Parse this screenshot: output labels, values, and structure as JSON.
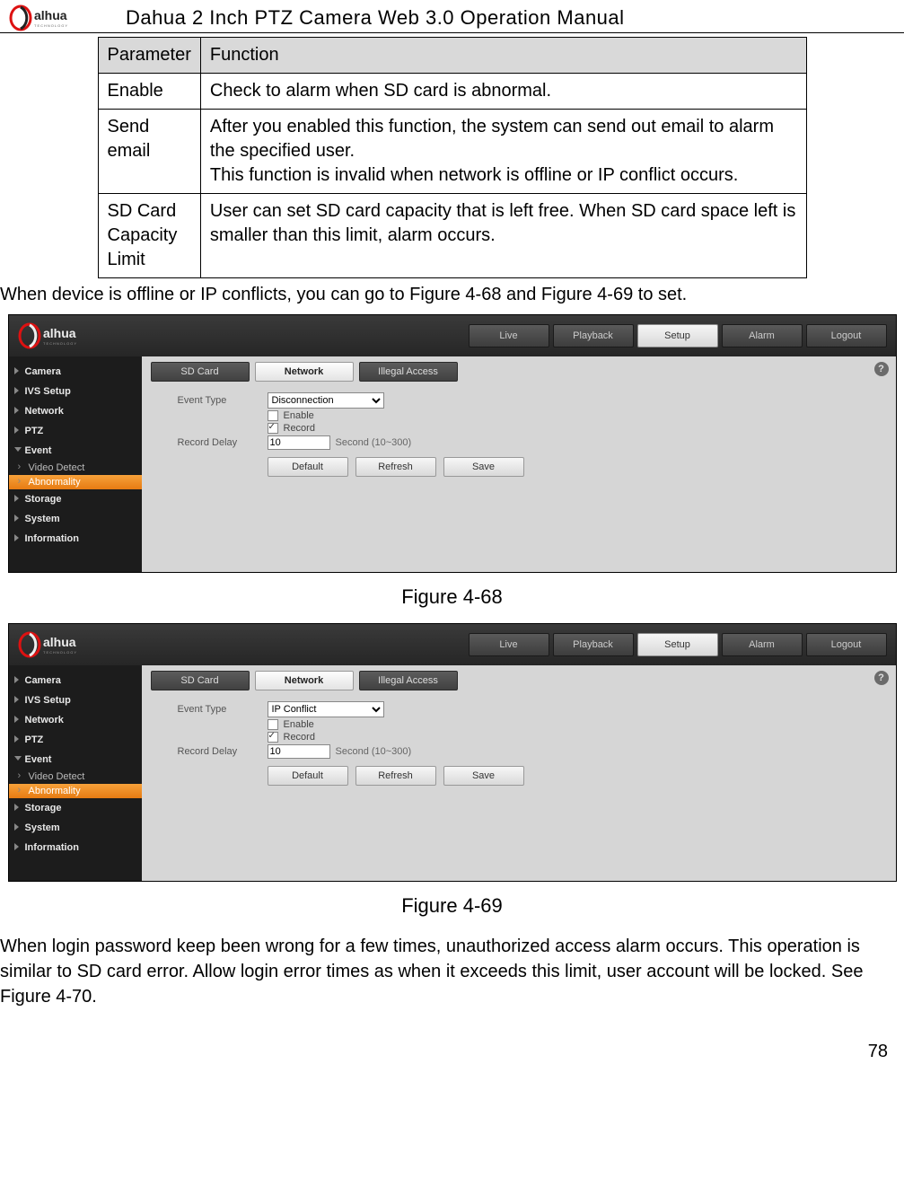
{
  "doc": {
    "title": "Dahua 2 Inch PTZ Camera Web 3.0 Operation Manual",
    "page_number": "78"
  },
  "param_table": {
    "headers": [
      "Parameter",
      "Function"
    ],
    "rows": [
      {
        "param": "Enable",
        "func": "Check to alarm when SD card is abnormal."
      },
      {
        "param": "Send email",
        "func": "After you enabled this function, the system can send out email to alarm the specified user.\nThis function is invalid when network is offline or IP conflict occurs."
      },
      {
        "param": "SD Card Capacity Limit",
        "func": "User can set SD card capacity that is left free. When SD card space left is smaller than this limit, alarm occurs."
      }
    ]
  },
  "text": {
    "intro": "When device is offline or IP conflicts, you can go to Figure 4-68 and Figure 4-69 to set.",
    "fig68": "Figure 4-68",
    "fig69": "Figure 4-69",
    "outro": "When login password keep been wrong for a few times, unauthorized access alarm occurs. This operation is similar to SD card error. Allow login error times as when it exceeds this limit, user account will be locked. See Figure 4-70."
  },
  "topnav": {
    "items": [
      "Live",
      "Playback",
      "Setup",
      "Alarm",
      "Logout"
    ],
    "active": "Setup"
  },
  "sidebar": {
    "items": [
      {
        "label": "Camera",
        "type": "item"
      },
      {
        "label": "IVS Setup",
        "type": "item"
      },
      {
        "label": "Network",
        "type": "item"
      },
      {
        "label": "PTZ",
        "type": "item"
      },
      {
        "label": "Event",
        "type": "item",
        "open": true
      },
      {
        "label": "Video Detect",
        "type": "sub"
      },
      {
        "label": "Abnormality",
        "type": "sub",
        "active": true
      },
      {
        "label": "Storage",
        "type": "item"
      },
      {
        "label": "System",
        "type": "item"
      },
      {
        "label": "Information",
        "type": "item"
      }
    ]
  },
  "subtabs": {
    "items": [
      "SD Card",
      "Network",
      "Illegal Access"
    ],
    "active": "Network"
  },
  "form": {
    "event_type_label": "Event Type",
    "enable_label": "Enable",
    "record_label": "Record",
    "record_delay_label": "Record Delay",
    "record_delay_value": "10",
    "record_delay_hint": "Second (10~300)",
    "buttons": [
      "Default",
      "Refresh",
      "Save"
    ]
  },
  "shot1": {
    "event_type_value": "Disconnection"
  },
  "shot2": {
    "event_type_value": "IP Conflict"
  },
  "help_glyph": "?"
}
